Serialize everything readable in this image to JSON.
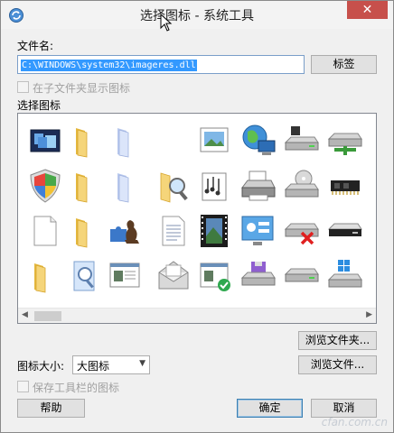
{
  "window": {
    "title": "选择图标 - 系统工具",
    "close_glyph": "✕"
  },
  "file": {
    "label": "文件名:",
    "value": "C:\\WINDOWS\\system32\\imageres.dll",
    "tag_button": "标签"
  },
  "subfolder_checkbox": {
    "label": "在子文件夹显示图标",
    "checked": false
  },
  "icon_panel": {
    "label": "选择图标",
    "rows": [
      [
        "display-screens-icon",
        "folder-icon",
        "document-stack-icon",
        "blank-icon",
        "picture-frame-icon",
        "network-globe-icon",
        "drive-icon",
        "network-drive-icon",
        "partial-icon"
      ],
      [
        "security-shield-icon",
        "folder-icon",
        "document-stack-icon",
        "blank-icon",
        "folder-search-icon",
        "music-document-icon",
        "printer-icon",
        "cd-drive-icon",
        "memory-chip-icon"
      ],
      [
        "blank-document-icon",
        "folder-icon",
        "puzzle-chess-icon",
        "text-document-icon",
        "film-strip-icon",
        "control-panel-icon",
        "drive-error-icon",
        "drive-slim-icon",
        "partial-icon"
      ],
      [
        "folder-icon",
        "search-document-icon",
        "window-document-icon",
        "mail-envelope-icon",
        "window-check-icon",
        "floppy-drive-icon",
        "drive-icon",
        "windows-drive-icon",
        "partial-icon"
      ]
    ]
  },
  "scrollbar": {
    "left_glyph": "◀",
    "right_glyph": "▶"
  },
  "browse_folder_button": "浏览文件夹...",
  "icon_size": {
    "label": "图标大小:",
    "selected": "大图标",
    "chevron": "▼"
  },
  "browse_file_button": "浏览文件...",
  "save_toolbar_checkbox": {
    "label": "保存工具栏的图标",
    "checked": false
  },
  "footer": {
    "help_button": "帮助",
    "ok_button": "确定",
    "cancel_button": "取消"
  },
  "watermark": {
    "text": "cfan.com.cn"
  },
  "colors": {
    "close_red": "#c7504b",
    "selection_blue": "#3399ff",
    "folder_yellow": "#f2c94c",
    "default_button_border": "#3c7fb1"
  }
}
